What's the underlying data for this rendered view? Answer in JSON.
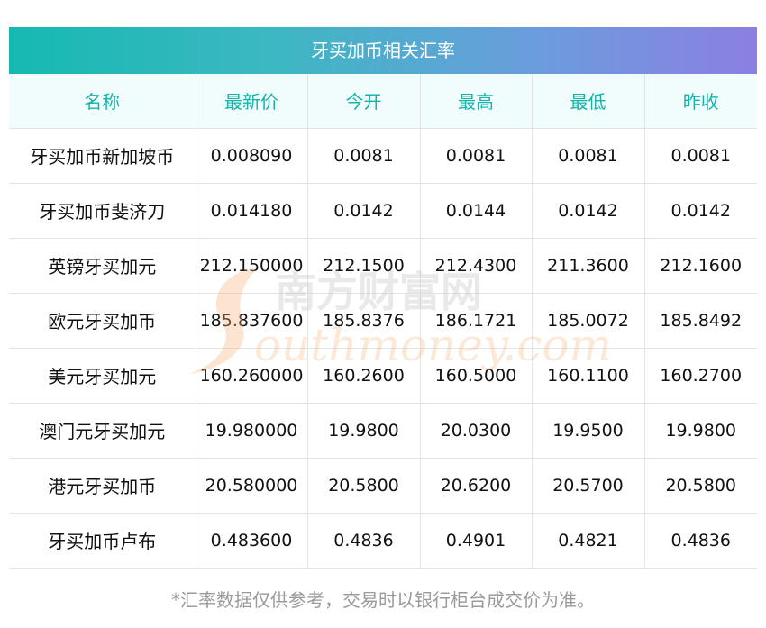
{
  "title": "牙买加币相关汇率",
  "columns": [
    "名称",
    "最新价",
    "今开",
    "最高",
    "最低",
    "昨收"
  ],
  "rows": [
    [
      "牙买加币新加坡币",
      "0.008090",
      "0.0081",
      "0.0081",
      "0.0081",
      "0.0081"
    ],
    [
      "牙买加币斐济刀",
      "0.014180",
      "0.0142",
      "0.0144",
      "0.0142",
      "0.0142"
    ],
    [
      "英镑牙买加元",
      "212.150000",
      "212.1500",
      "212.4300",
      "211.3600",
      "212.1600"
    ],
    [
      "欧元牙买加币",
      "185.837600",
      "185.8376",
      "186.1721",
      "185.0072",
      "185.8492"
    ],
    [
      "美元牙买加元",
      "160.260000",
      "160.2600",
      "160.5000",
      "160.1100",
      "160.2700"
    ],
    [
      "澳门元牙买加元",
      "19.980000",
      "19.9800",
      "20.0300",
      "19.9500",
      "19.9800"
    ],
    [
      "港元牙买加币",
      "20.580000",
      "20.5800",
      "20.6200",
      "20.5700",
      "20.5800"
    ],
    [
      "牙买加币卢布",
      "0.483600",
      "0.4836",
      "0.4901",
      "0.4821",
      "0.4836"
    ]
  ],
  "footnote": "*汇率数据仅供参考，交易时以银行柜台成交价为准。",
  "watermark": {
    "cn": "南方财富网",
    "en": "outhmoney.com"
  },
  "colors": {
    "header_text": "#15b2ab",
    "header_bg": "#f1fdfc",
    "gradient_start": "#16b9b1",
    "gradient_end": "#8c7fe2",
    "footnote": "#9a9a9a"
  }
}
